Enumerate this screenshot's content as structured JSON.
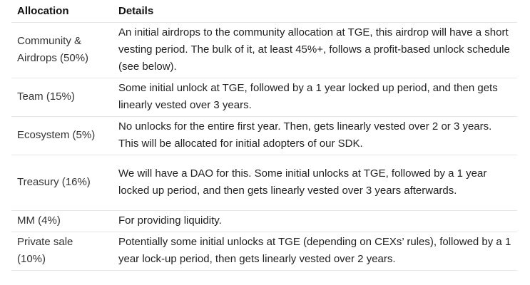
{
  "table": {
    "headers": [
      "Allocation",
      "Details"
    ],
    "rows": [
      {
        "allocation": "Community & Airdrops (50%)",
        "details": "An initial airdrops to the community allocation at TGE, this airdrop will have a short vesting period. The bulk of it, at least 45%+, follows a profit-based unlock schedule (see below)."
      },
      {
        "allocation": "Team (15%)",
        "details": "Some initial unlock at TGE, followed by a 1 year locked up period, and then gets linearly vested over 3 years."
      },
      {
        "allocation": "Ecosystem (5%)",
        "details": "No unlocks for the entire first year. Then, gets linearly vested over 2 or 3 years. This will be allocated for initial adopters of our SDK."
      },
      {
        "allocation": "Treasury (16%)",
        "details": "We will have a DAO for this. Some initial unlocks at TGE, followed by a 1 year locked up period, and then gets linearly vested over 3 years afterwards."
      },
      {
        "allocation": "MM (4%)",
        "details": "For providing liquidity."
      },
      {
        "allocation": "Private sale (10%)",
        "details": "Potentially some initial unlocks at TGE (depending on CEXs’ rules), followed by a 1 year lock-up period, then gets linearly vested over 2 years."
      }
    ]
  }
}
